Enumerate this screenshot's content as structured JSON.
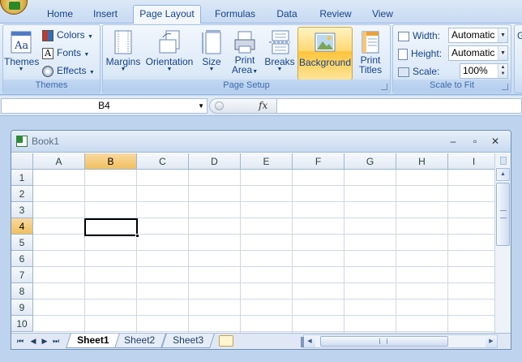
{
  "ribbon_tabs": [
    {
      "label": "Home",
      "active": false
    },
    {
      "label": "Insert",
      "active": false
    },
    {
      "label": "Page Layout",
      "active": true
    },
    {
      "label": "Formulas",
      "active": false
    },
    {
      "label": "Data",
      "active": false
    },
    {
      "label": "Review",
      "active": false
    },
    {
      "label": "View",
      "active": false
    }
  ],
  "groups": {
    "themes": {
      "label": "Themes",
      "themes_button": "Themes",
      "colors": "Colors",
      "fonts": "Fonts",
      "effects": "Effects"
    },
    "page_setup": {
      "label": "Page Setup",
      "margins": "Margins",
      "orientation": "Orientation",
      "size": "Size",
      "print_area_line1": "Print",
      "print_area_line2": "Area",
      "breaks": "Breaks",
      "background": "Background",
      "print_titles_line1": "Print",
      "print_titles_line2": "Titles"
    },
    "scale_to_fit": {
      "label": "Scale to Fit",
      "width_label": "Width:",
      "width_value": "Automatic",
      "height_label": "Height:",
      "height_value": "Automatic",
      "scale_label": "Scale:",
      "scale_value": "100%"
    },
    "sheet_options_clipped": "G"
  },
  "formula_bar": {
    "name_box": "B4",
    "fx_label": "fx",
    "formula": ""
  },
  "workbook": {
    "title": "Book1",
    "columns": [
      "A",
      "B",
      "C",
      "D",
      "E",
      "F",
      "G",
      "H",
      "I"
    ],
    "rows": [
      "1",
      "2",
      "3",
      "4",
      "5",
      "6",
      "7",
      "8",
      "9",
      "10"
    ],
    "selected_column": "B",
    "selected_row": "4",
    "active_cell": "B4"
  },
  "sheet_tabs": [
    {
      "label": "Sheet1",
      "active": true
    },
    {
      "label": "Sheet2",
      "active": false
    },
    {
      "label": "Sheet3",
      "active": false
    }
  ],
  "colors": {
    "ribbon_text": "#15428b",
    "selected_header": "#f1c15f",
    "gridline": "#d0d7e5",
    "hot_button": "#ffd874"
  }
}
